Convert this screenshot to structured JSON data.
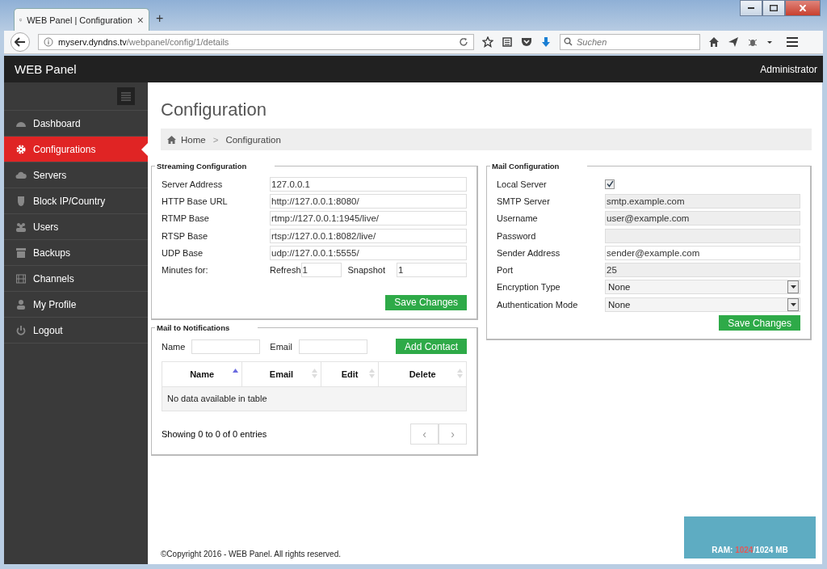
{
  "browser": {
    "tab_title": "WEB Panel | Configuration",
    "tab_close": "×",
    "new_tab": "+",
    "url_host": "myserv.dyndns.tv",
    "url_path": "/webpanel/config/1/details",
    "search": {
      "placeholder": "Suchen"
    }
  },
  "header": {
    "brand": "WEB Panel",
    "user": "Administrator"
  },
  "sidebar": {
    "items": [
      {
        "label": "Dashboard",
        "kind": "dashboard",
        "selected": false
      },
      {
        "label": "Configurations",
        "kind": "gear",
        "selected": true
      },
      {
        "label": "Servers",
        "kind": "cloud",
        "selected": false
      },
      {
        "label": "Block IP/Country",
        "kind": "shield",
        "selected": false
      },
      {
        "label": "Users",
        "kind": "users",
        "selected": false
      },
      {
        "label": "Backups",
        "kind": "archive",
        "selected": false
      },
      {
        "label": "Channels",
        "kind": "film",
        "selected": false
      },
      {
        "label": "My Profile",
        "kind": "user",
        "selected": false
      },
      {
        "label": "Logout",
        "kind": "power",
        "selected": false
      }
    ]
  },
  "page_title": "Configuration",
  "breadcrumb": [
    {
      "label": "Home",
      "kind": "home"
    },
    {
      "label": "Configuration",
      "kind": "current"
    }
  ],
  "breadcrumb_separator": ">",
  "streaming": {
    "title": "Streaming Configuration",
    "fields": [
      {
        "label": "Server Address",
        "value": "127.0.0.1"
      },
      {
        "label": "HTTP Base URL",
        "value": "http://127.0.0.1:8080/"
      },
      {
        "label": "RTMP Base",
        "value": "rtmp://127.0.0.1:1945/live/"
      },
      {
        "label": "RTSP Base",
        "value": "rtsp://127.0.0.1:8082/live/"
      },
      {
        "label": "UDP Base",
        "value": "udp://127.0.0.1:5555/"
      }
    ],
    "minutes": {
      "label": "Minutes for:",
      "refresh_label": "Refresh",
      "refresh": "1",
      "snapshot_label": "Snapshot",
      "snapshot": "1"
    },
    "button": "Save Changes"
  },
  "mail": {
    "title": "Mail Configuration",
    "fields": [
      {
        "label": "Local Server",
        "kind": "checkbox",
        "checked": true
      },
      {
        "label": "SMTP Server",
        "kind": "text",
        "value": "smtp.example.com",
        "disabled": true
      },
      {
        "label": "Username",
        "kind": "text",
        "value": "user@example.com",
        "disabled": true
      },
      {
        "label": "Password",
        "kind": "text",
        "disabled": true
      },
      {
        "label": "Sender Address",
        "kind": "text",
        "value": "sender@example.com",
        "disabled": false
      },
      {
        "label": "Port",
        "kind": "text",
        "value": "25",
        "disabled": true
      },
      {
        "label": "Encryption Type",
        "kind": "select",
        "value": "None"
      },
      {
        "label": "Authentication Mode",
        "kind": "select",
        "value": "None"
      }
    ],
    "button": "Save Changes"
  },
  "notifications": {
    "title": "Mail to Notifications",
    "name_label": "Name",
    "email_label": "Email",
    "button": "Add Contact",
    "table": {
      "columns": [
        {
          "label": "Name",
          "sorted": true
        },
        {
          "label": "Email",
          "sorted": false
        },
        {
          "label": "Edit",
          "sorted": false
        },
        {
          "label": "Delete",
          "sorted": false
        }
      ],
      "empty": "No data available in table"
    },
    "info": "Showing 0 to 0 of 0 entries",
    "prev": "‹",
    "next": "›"
  },
  "stats": {
    "ram_label": "RAM:",
    "ram_used": "1024",
    "ram_total": "/1024 MB"
  },
  "footer": "©Copyright 2016 - WEB Panel. All rights reserved."
}
